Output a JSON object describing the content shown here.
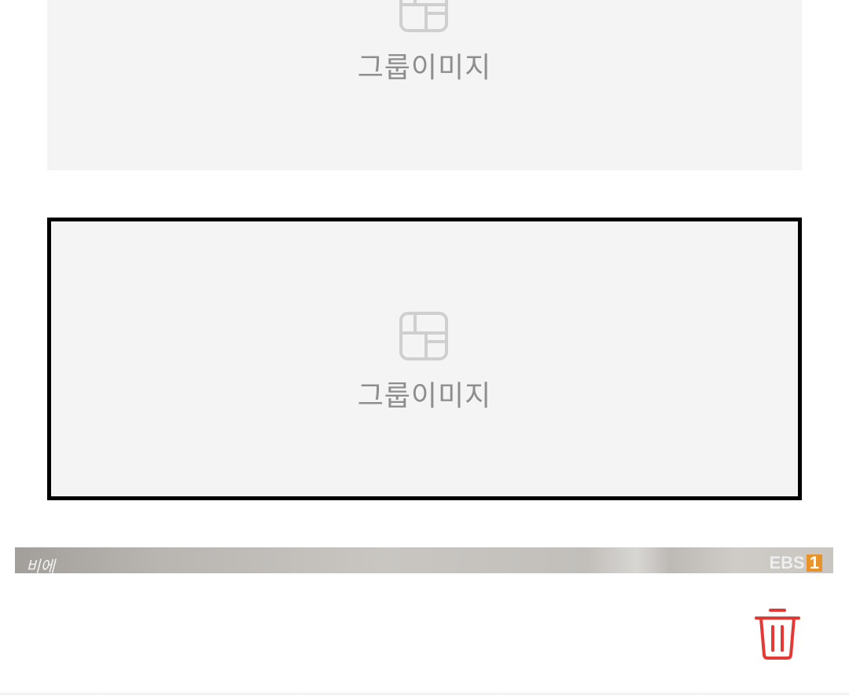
{
  "group_cards": [
    {
      "icon": "group-image-icon",
      "label": "그룹이미지",
      "selected": false
    },
    {
      "icon": "group-image-icon",
      "label": "그룹이미지",
      "selected": true
    }
  ],
  "thumbnail": {
    "left_mark": "비에",
    "logo_text": "EBS",
    "logo_number": "1"
  },
  "actions": {
    "delete_icon": "trash-icon",
    "delete_color": "#e53935"
  },
  "colors": {
    "card_background": "#f4f4f4",
    "placeholder_text": "#8e8e8e",
    "selected_border": "#000000"
  }
}
